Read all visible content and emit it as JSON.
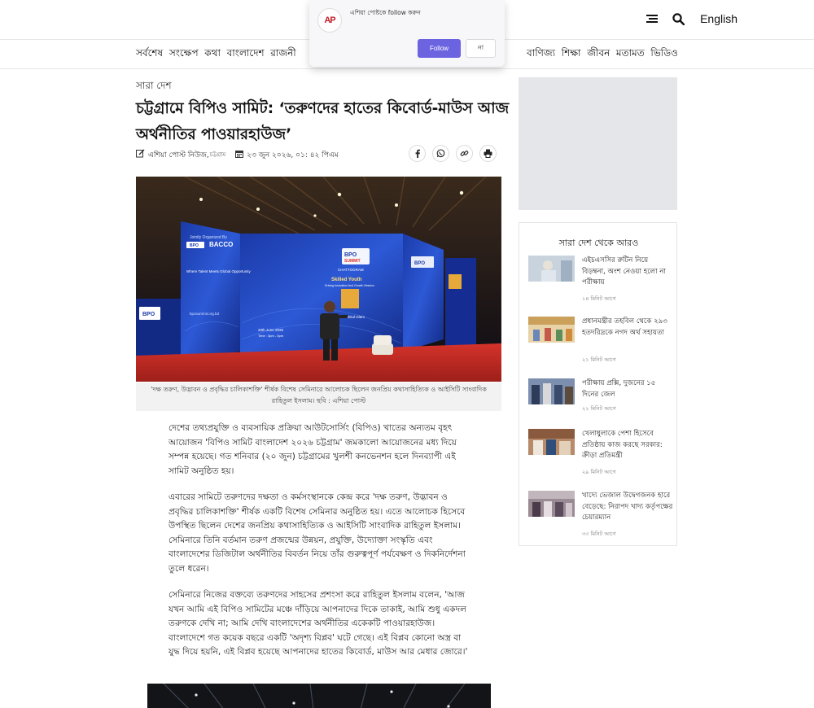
{
  "header": {
    "language": "English",
    "logo_text": "AP",
    "nav": [
      "সর্বশেষ",
      "সংক্ষেপ",
      "কথা",
      "বাংলাদেশ",
      "রাজনী",
      "বাণিজ্য",
      "শিক্ষা",
      "জীবন",
      "মতামত",
      "ভিডিও"
    ]
  },
  "popup": {
    "text": "এশিয়া পোষ্টকে follow করুন",
    "follow_label": "Follow",
    "no_label": "না"
  },
  "article": {
    "section": "সারা দেশ",
    "headline": "চট্টগ্রামে বিপিও সামিট: ‘তরুণদের হাতের কিবোর্ড-মাউস আজ অর্থনীতির পাওয়ারহাউজ’",
    "author": "এশিয়া পোস্ট নিউজ,",
    "location": "চট্টগ্রাম",
    "date": "২৩ জুন ২০২৬, ০১: ৪২ পিএম",
    "caption": "'দক্ষ তরুণ, উদ্ভাবন ও প্রবৃদ্ধির চালিকাশক্তি' শীর্ষক বিশেষ সেমিনারে আলোচক ছিলেন জনপ্রিয় কথাসাহিত্যিক ও আইসিটি সাংবাদিক রাহিতুল ইসলাম। ছবি : এশিয়া পোস্ট",
    "paragraphs": [
      "দেশের তথ্যপ্রযুক্তি ও ব্যবসায়িক প্রক্রিয়া আউটসোর্সিং (বিপিও) খাতের অন্যতম বৃহৎ আয়োজন 'বিপিও সামিট বাংলাদেশ ২০২৬ চট্টগ্রাম' জমকালো আয়োজনের মধ্য দিয়ে সম্পন্ন হয়েছে। গত শনিবার (২০ জুন) চট্টগ্রামের খুলশী কনভেনশন হলে দিনব্যাপী এই সামিট অনুষ্ঠিত হয়।",
      "এবারের সামিটে তরুণদের দক্ষতা ও কর্মসংস্থানকে কেন্দ্র করে 'দক্ষ তরুণ, উদ্ভাবন ও প্রবৃদ্ধির চালিকাশক্তি' শীর্ষক একটি বিশেষ সেমিনার অনুষ্ঠিত হয়। এতে আলোচক হিসেবে উপস্থিত ছিলেন দেশের জনপ্রিয় কথাসাহিত্যিক ও আইসিটি সাংবাদিক রাহিতুল ইসলাম। সেমিনারে তিনি বর্তমান তরুণ প্রজন্মের উন্নয়ন, প্রযুক্তি, উদ্যোক্তা সংস্কৃতি এবং বাংলাদেশের ডিজিটাল অর্থনীতির বিবর্তন নিয়ে তাঁর গুরুত্বপূর্ণ পর্যবেক্ষণ ও দিকনির্দেশনা তুলে ধরেন।",
      "সেমিনারে নিজের বক্তব্যে তরুণদের সাহসের প্রশংসা করে রাহিতুল ইসলাম বলেন, 'আজ যখন আমি এই বিপিও সামিটের মঞ্চে দাঁড়িয়ে আপনাদের দিকে তাকাই, আমি শুধু একদল তরুণকে দেখি না; আমি দেখি বাংলাদেশের অর্থনীতির একেকটি পাওয়ারহাউজ। বাংলাদেশে গত কয়েক বছরে একটি 'অদৃশ্য বিপ্লব' ঘটে গেছে। এই বিপ্লব কোনো অস্ত্র বা যুদ্ধ দিয়ে হয়নি, এই বিপ্লব হয়েছে আপনাদের হাতের কিবোর্ড, মাউস আর মেধার জোরে।'"
    ],
    "stage_text": {
      "joint": "Jointly Organized By",
      "org": "BACCO",
      "bpo1": "BPO",
      "bpo2": "SUMMIT",
      "city": "CHATTOGRAM",
      "session": "Skilled Youth",
      "session_sub": "Driving Innovation And Growth Session",
      "speaker": "Rahitul Islam",
      "date": "20th June 2026",
      "time": "Time : 3pm - 5pm",
      "talent": "Where Talent Meets Global Opportunity",
      "site": "bposummit.org.bd"
    }
  },
  "sidebar": {
    "more_title": "সারা দেশ থেকে আরও",
    "items": [
      {
        "title": "এইচএসসির রুটিন নিয়ে বিড়ম্বনা, অংশ নেওয়া হলো না পরীক্ষায়",
        "time": "১৪ মিনিট আগে",
        "color": "#b9c7d6"
      },
      {
        "title": "প্রধানমন্ত্রীর তহবিল থেকে ২৯৩ হতদরিদ্রকে নগদ অর্থ সহায়তা",
        "time": "২১ মিনিট আগে",
        "color": "#d6a35b"
      },
      {
        "title": "পরীক্ষায় প্রক্সি, দুজনের ১৫ দিনের জেল",
        "time": "২২ মিনিট আগে",
        "color": "#5b6f9a"
      },
      {
        "title": "খেলাধুলাকে পেশা হিসেবে প্রতিষ্ঠায় কাজ করছে সরকার: ক্রীড়া প্রতিমন্ত্রী",
        "time": "২৯ মিনিট আগে",
        "color": "#c48b6a"
      },
      {
        "title": "খাদ্যে ভেজাল উদ্বেগজনক হারে বেড়েছে: নিরাপদ খাদ্য কর্তৃপক্ষের চেয়ারম্যান",
        "time": "৩৩ মিনিট আগে",
        "color": "#8a7a86"
      }
    ]
  }
}
